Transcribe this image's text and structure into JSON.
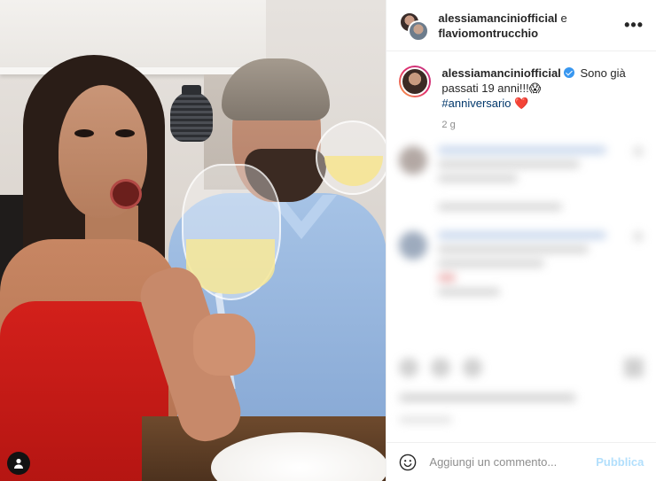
{
  "header": {
    "user1": "alessiamanciniofficial",
    "conjunction": "e",
    "user2": "flaviomontrucchio",
    "more_label": "•••"
  },
  "caption": {
    "username": "alessiamanciniofficial",
    "text": "Sono già passati 19 anni!!!😱",
    "hashtag": "#anniversario",
    "emoji": "❤️",
    "time": "2 g"
  },
  "comment_bar": {
    "placeholder": "Aggiungi un commento...",
    "publish_label": "Pubblica"
  },
  "colors": {
    "verified": "#3897f0",
    "hashtag": "#00376b",
    "publish_disabled": "#b2dffc"
  }
}
